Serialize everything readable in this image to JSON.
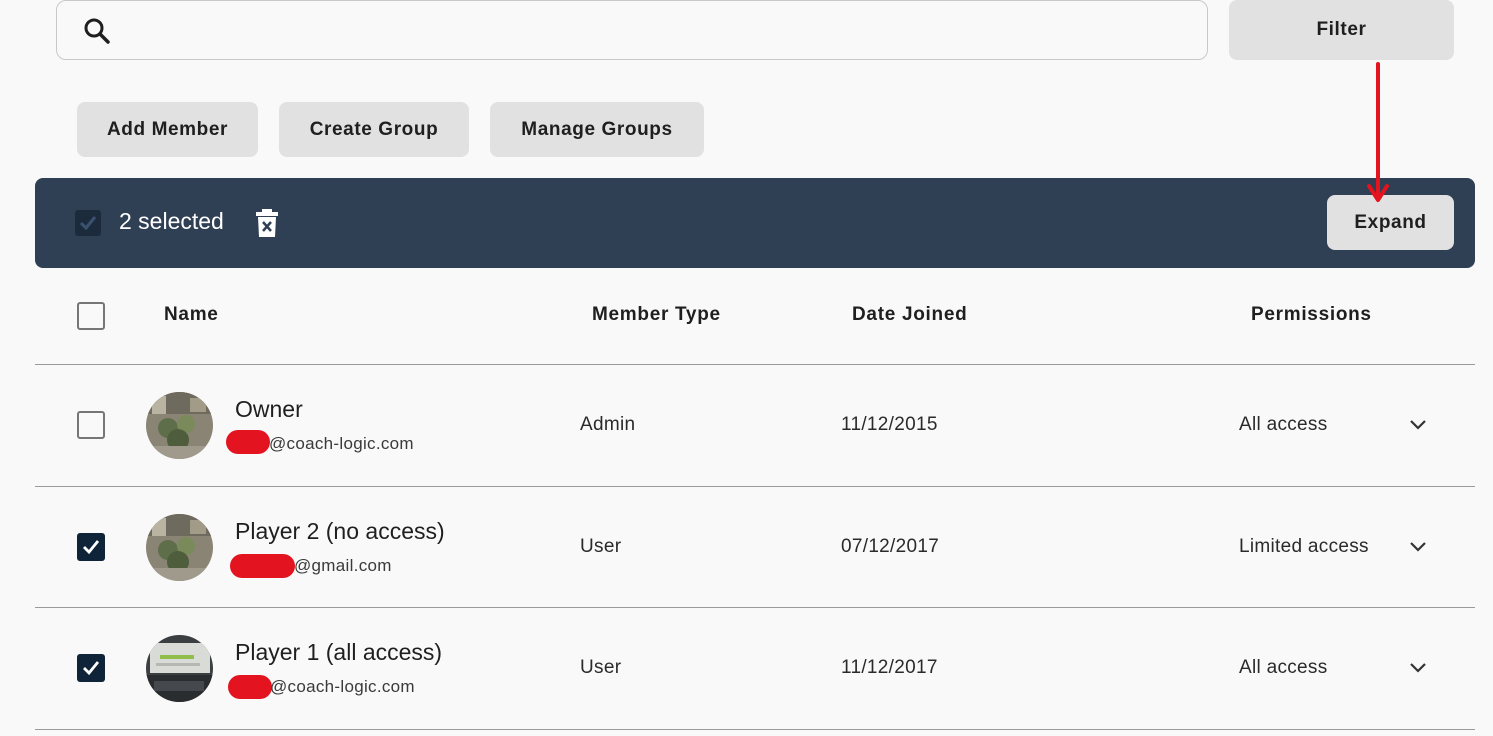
{
  "search": {
    "placeholder": "",
    "value": ""
  },
  "toolbar": {
    "filter_label": "Filter",
    "add_member_label": "Add Member",
    "create_group_label": "Create Group",
    "manage_groups_label": "Manage Groups"
  },
  "selection_bar": {
    "selected_text": "2 selected",
    "expand_label": "Expand"
  },
  "table": {
    "headers": {
      "name": "Name",
      "member_type": "Member Type",
      "date_joined": "Date Joined",
      "permissions": "Permissions"
    },
    "rows": [
      {
        "checked": false,
        "name": "Owner",
        "email_domain": "@coach-logic.com",
        "member_type": "Admin",
        "date_joined": "11/12/2015",
        "permissions": "All access"
      },
      {
        "checked": true,
        "name": "Player 2 (no access)",
        "email_domain": "@gmail.com",
        "member_type": "User",
        "date_joined": "07/12/2017",
        "permissions": "Limited access"
      },
      {
        "checked": true,
        "name": "Player 1 (all access)",
        "email_domain": "@coach-logic.com",
        "member_type": "User",
        "date_joined": "11/12/2017",
        "permissions": "All access"
      }
    ]
  },
  "colors": {
    "selection_bar_bg": "#2f3f54",
    "checkbox_checked": "#0f2438",
    "button_gray": "#e1e1e1",
    "annotation_arrow": "#e3131f",
    "redaction": "#e3131f"
  },
  "icons": {
    "search": "search-icon",
    "delete": "trash-icon",
    "row_expand": "chevron-down-icon",
    "annotation": "red-arrow-annotation"
  }
}
